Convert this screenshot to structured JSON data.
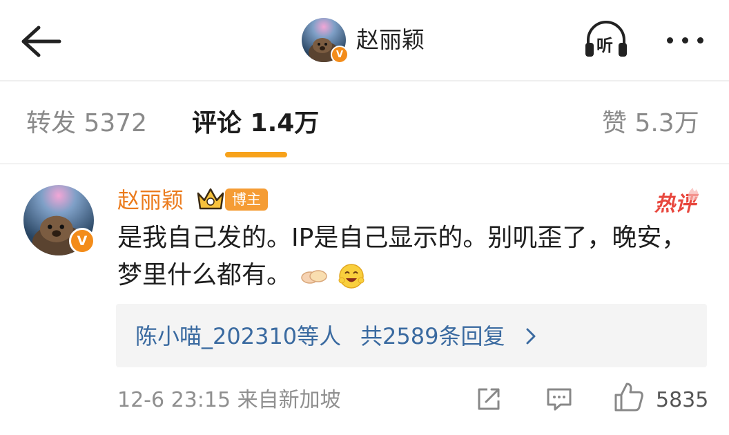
{
  "header": {
    "name": "赵丽颖",
    "listen_label": "听",
    "avatar_badge": "V"
  },
  "tabs": {
    "repost": "转发 5372",
    "comments": "评论 1.4万",
    "likes": "赞 5.3万"
  },
  "comment": {
    "author": "赵丽颖",
    "role_tag": "博主",
    "hot_tag": "热评",
    "avatar_badge": "V",
    "text": "是我自己发的。IP是自己显示的。别叽歪了，晚安，梦里什么都有。",
    "emojis": [
      "handshake-emoji",
      "laughing-emoji"
    ],
    "replies": {
      "users": "陈小喵_202310等人",
      "count": "共2589条回复"
    },
    "timestamp": "12-6 23:15 来自新加坡",
    "like_count": "5835"
  },
  "colors": {
    "accent": "#f7a21b",
    "name_orange": "#eb7b1d",
    "link_blue": "#3a6aa0",
    "hot_red": "#e8473e"
  }
}
